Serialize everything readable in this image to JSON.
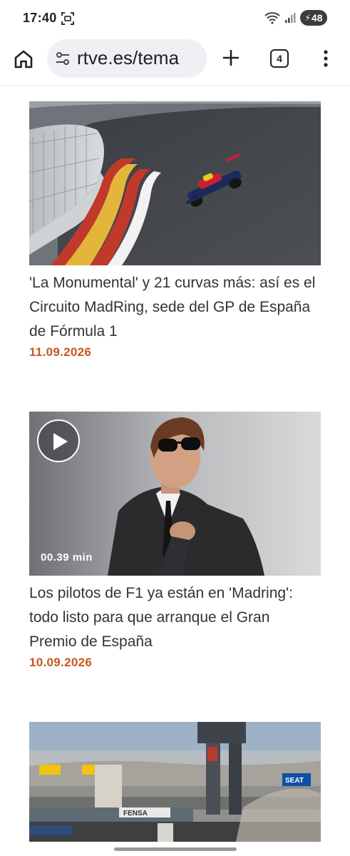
{
  "status_bar": {
    "time": "17:40",
    "battery": "48",
    "icons": [
      "screen-record-icon",
      "wifi-icon",
      "signal-icon",
      "battery-icon"
    ]
  },
  "browser": {
    "url": "rtve.es/tema",
    "tab_count": "4",
    "icons": [
      "home-icon",
      "site-settings-icon",
      "new-tab-icon",
      "tab-switcher-icon",
      "menu-icon"
    ]
  },
  "articles": [
    {
      "title": "'La Monumental' y 21 curvas más: así es el Circuito MadRing, sede del GP de España de Fórmula 1",
      "date": "11.09.2026",
      "image": "race-car-on-track-photo"
    },
    {
      "title": "Los pilotos de F1 ya están en 'Madring': todo listo para que arranque el Gran Premio de España",
      "date": "10.09.2026",
      "image": "driver-in-sunglasses-photo",
      "video_duration": "00.39 min"
    },
    {
      "title": "",
      "date": "",
      "image": "circuit-grandstand-photo",
      "signs": {
        "seat": "SEAT",
        "fensa": "FENSA"
      }
    }
  ],
  "colors": {
    "date": "#c8561e",
    "headline": "#333333",
    "omnibox": "#eef0f4"
  }
}
